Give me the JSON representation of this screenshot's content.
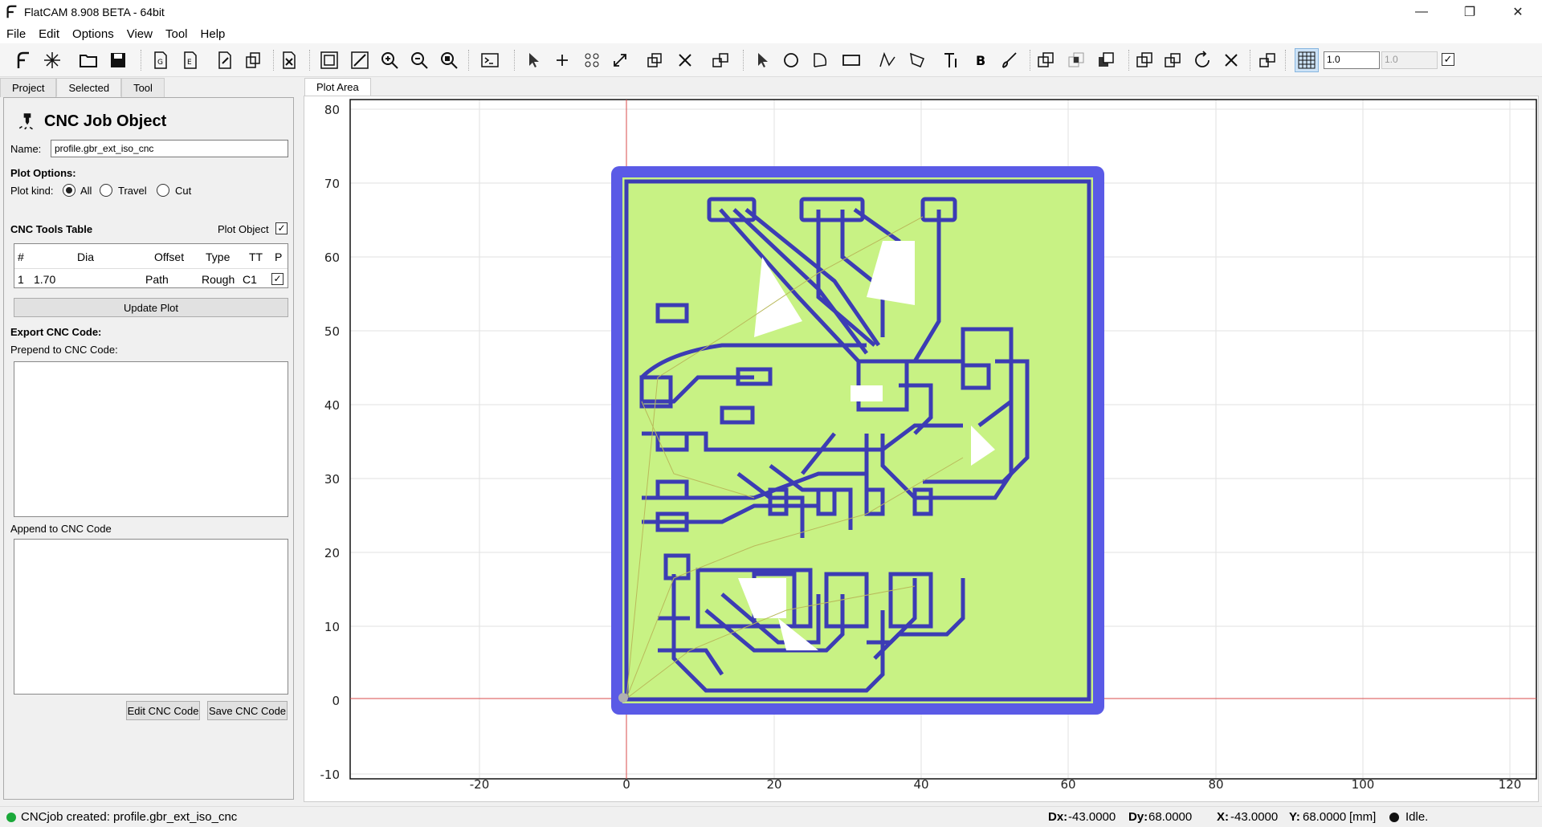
{
  "window": {
    "title": "FlatCAM 8.908 BETA - 64bit"
  },
  "menu": [
    "File",
    "Edit",
    "Options",
    "View",
    "Tool",
    "Help"
  ],
  "toolbar": {
    "grid_x": "1.0",
    "grid_y": "1.0"
  },
  "left_tabs": [
    "Project",
    "Selected",
    "Tool"
  ],
  "panel": {
    "title": "CNC Job Object",
    "name_label": "Name:",
    "name_value": "profile.gbr_ext_iso_cnc",
    "plot_options": "Plot Options:",
    "plot_kind_label": "Plot kind:",
    "plot_kind_options": [
      "All",
      "Travel",
      "Cut"
    ],
    "plot_kind_selected": "All",
    "tools_table_label": "CNC Tools Table",
    "plot_object_label": "Plot Object",
    "table_headers": [
      "#",
      "Dia",
      "Offset",
      "Type",
      "TT",
      "P"
    ],
    "table_rows": [
      [
        "1",
        "1.70",
        "Path",
        "Rough",
        "C1"
      ]
    ],
    "update_plot": "Update Plot",
    "export_label": "Export CNC Code:",
    "prepend_label": "Prepend to CNC Code:",
    "append_label": "Append to CNC Code",
    "edit_btn": "Edit CNC Code",
    "save_btn": "Save CNC Code"
  },
  "plot": {
    "tab": "Plot Area",
    "x_ticks": [
      "-20",
      "0",
      "20",
      "40",
      "60",
      "80",
      "100",
      "120"
    ],
    "y_ticks": [
      "80",
      "70",
      "60",
      "50",
      "40",
      "30",
      "20",
      "10",
      "0",
      "-10"
    ]
  },
  "status": {
    "message": "CNCjob created: profile.gbr_ext_iso_cnc",
    "dx_label": "Dx:",
    "dx": "-43.0000",
    "dy_label": "Dy:",
    "dy": "68.0000",
    "x_label": "X:",
    "x": "-43.0000",
    "y_label": "Y:",
    "y": "68.0000",
    "units": "[mm]",
    "state": "Idle."
  },
  "colors": {
    "board": "#c8f284",
    "trace": "#3c3cb4",
    "outline": "#5a5ae6",
    "axis": "#d84b4b"
  }
}
